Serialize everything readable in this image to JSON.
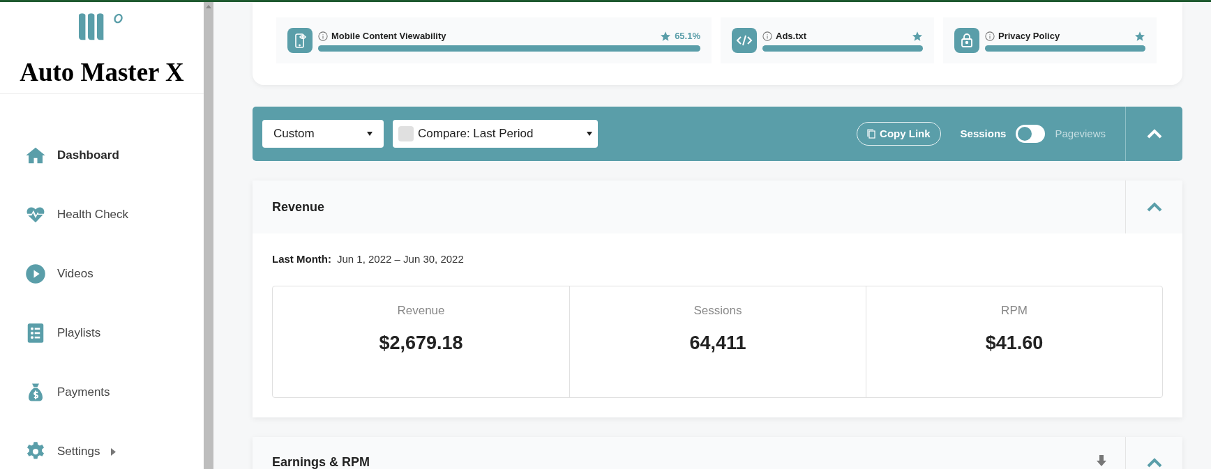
{
  "sidebar": {
    "title": "Auto Master X",
    "items": [
      {
        "label": "Dashboard",
        "selected": true
      },
      {
        "label": "Health Check",
        "selected": false
      },
      {
        "label": "Videos",
        "selected": false
      },
      {
        "label": "Playlists",
        "selected": false
      },
      {
        "label": "Payments",
        "selected": false
      },
      {
        "label": "Settings",
        "selected": false,
        "submenu": true
      }
    ]
  },
  "health_metrics": [
    {
      "label": "Mobile Content Viewability",
      "value": "65.1%",
      "level": 1
    },
    {
      "label": "Ads.txt",
      "level": 1
    },
    {
      "label": "Privacy Policy",
      "level": 1
    }
  ],
  "filter_bar": {
    "range": "Custom",
    "compare": {
      "label": "Compare: Last Period",
      "checked": false
    },
    "copy_link": "Copy Link",
    "metric_toggle": [
      {
        "label": "Sessions",
        "selected": true
      },
      {
        "label": "Pageviews",
        "selected": false
      }
    ],
    "expanded": true
  },
  "revenue": {
    "title": "Revenue",
    "expanded": true,
    "period_label": "Last Month:",
    "period": "Jun 1, 2022 – Jun 30, 2022",
    "stats": [
      {
        "label": "Revenue",
        "value": "$2,679.18"
      },
      {
        "label": "Sessions",
        "value": "64,411"
      },
      {
        "label": "RPM",
        "value": "$41.60"
      }
    ]
  },
  "earnings": {
    "title": "Earnings & RPM",
    "expanded": true
  }
}
